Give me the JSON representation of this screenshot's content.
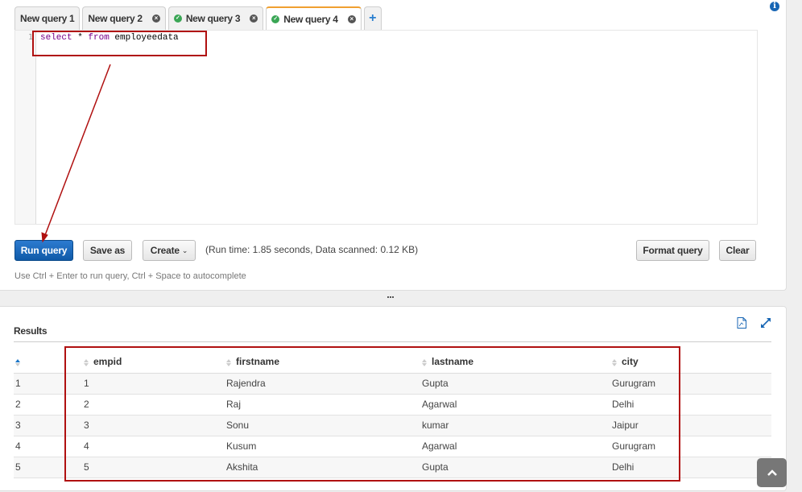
{
  "tabs": [
    {
      "label": "New query 1",
      "status": "none",
      "closable": false,
      "active": false
    },
    {
      "label": "New query 2",
      "status": "none",
      "closable": true,
      "active": false
    },
    {
      "label": "New query 3",
      "status": "success",
      "closable": true,
      "active": false
    },
    {
      "label": "New query 4",
      "status": "success",
      "closable": true,
      "active": true
    }
  ],
  "icons": {
    "add_tab": "+",
    "check": "✓",
    "close": "×",
    "info": "i",
    "scroll_top": "chevron-up"
  },
  "editor": {
    "line_number": "1",
    "query_keyword1": "select",
    "query_star": " * ",
    "query_keyword2": "from",
    "query_table": " employeedata"
  },
  "toolbar": {
    "run_label": "Run query",
    "save_label": "Save as",
    "create_label": "Create",
    "create_caret": "⌄",
    "run_stats": "(Run time: 1.85 seconds, Data scanned: 0.12 KB)",
    "format_label": "Format query",
    "clear_label": "Clear",
    "hint": "Use Ctrl + Enter to run query, Ctrl + Space to autocomplete"
  },
  "results": {
    "title": "Results",
    "columns": [
      "",
      "empid",
      "firstname",
      "lastname",
      "city"
    ],
    "rows": [
      [
        "1",
        "1",
        "Rajendra",
        "Gupta",
        "Gurugram"
      ],
      [
        "2",
        "2",
        "Raj",
        "Agarwal",
        "Delhi"
      ],
      [
        "3",
        "3",
        "Sonu",
        "kumar",
        "Jaipur"
      ],
      [
        "4",
        "4",
        "Kusum",
        "Agarwal",
        "Gurugram"
      ],
      [
        "5",
        "5",
        "Akshita",
        "Gupta",
        "Delhi"
      ]
    ]
  },
  "colors": {
    "primary": "#1866b4",
    "tab_active_accent": "#f0a030",
    "success": "#3aa655",
    "annotation": "#b01010",
    "keyword": "#770088"
  }
}
